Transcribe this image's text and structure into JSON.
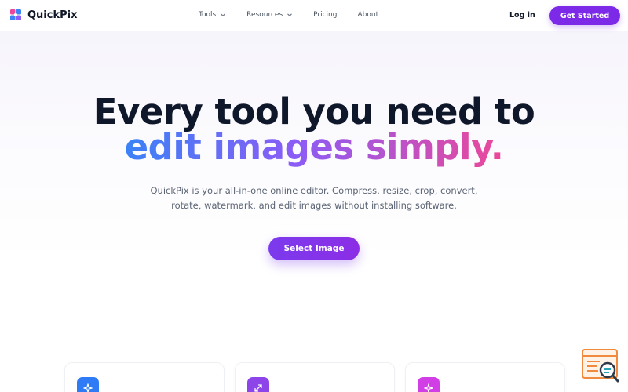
{
  "header": {
    "brand": "QuickPix",
    "nav": [
      {
        "label": "Tools",
        "has_dropdown": true
      },
      {
        "label": "Resources",
        "has_dropdown": true
      },
      {
        "label": "Pricing",
        "has_dropdown": false
      },
      {
        "label": "About",
        "has_dropdown": false
      }
    ],
    "login_label": "Log in",
    "cta_label": "Get Started"
  },
  "hero": {
    "title_line1": "Every tool you need to",
    "title_line2": "edit images simply.",
    "subtitle_line1": "QuickPix is your all-in-one online editor. Compress, resize, crop, convert,",
    "subtitle_line2": "rotate, watermark, and edit images without installing software.",
    "button_label": "Select Image"
  },
  "cards": [
    {
      "icon": "sparkle-icon",
      "color": "#2f7bf5"
    },
    {
      "icon": "resize-arrows-icon",
      "color": "#8d44e8"
    },
    {
      "icon": "sparkle-icon",
      "color": "#d13ee5"
    }
  ],
  "colors": {
    "accent": "#7c2ae8",
    "gradient": [
      "#3b82f6",
      "#8b5cf6",
      "#ec4899"
    ],
    "widget": "#f08a3e"
  },
  "widget": {
    "icon": "search-document-icon"
  }
}
